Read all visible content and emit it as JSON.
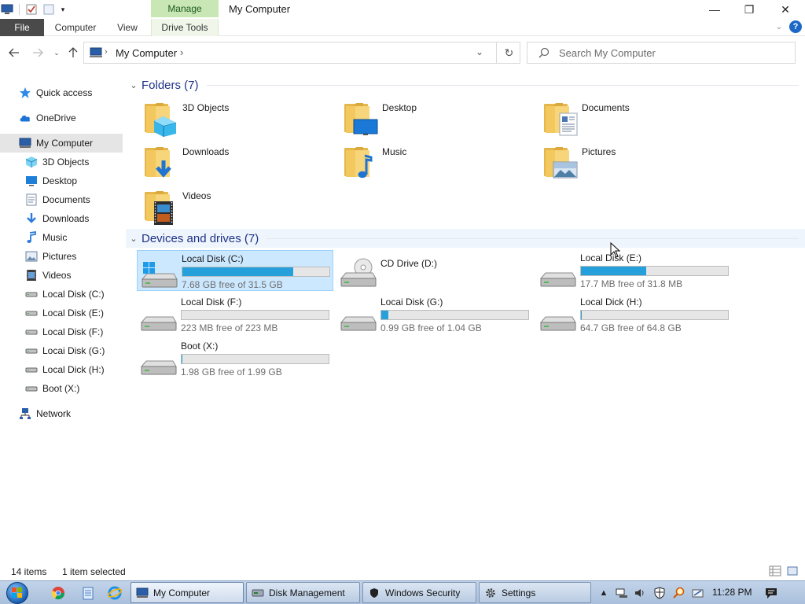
{
  "window": {
    "title": "My Computer",
    "contextual_tab": "Manage",
    "controls": {
      "minimize": "—",
      "maximize": "❐",
      "close": "✕"
    }
  },
  "ribbon": {
    "file": "File",
    "tabs": [
      "Computer",
      "View",
      "Drive Tools"
    ],
    "help": "?"
  },
  "address": {
    "path": "My Computer",
    "search_placeholder": "Search My Computer"
  },
  "nav_pane": {
    "items": [
      {
        "label": "Quick access",
        "icon": "star-icon"
      },
      {
        "label": "OneDrive",
        "icon": "cloud-icon"
      },
      {
        "label": "My Computer",
        "icon": "computer-icon",
        "selected": true
      },
      {
        "label": "3D Objects",
        "icon": "cube-icon"
      },
      {
        "label": "Desktop",
        "icon": "desktop-icon"
      },
      {
        "label": "Documents",
        "icon": "document-icon"
      },
      {
        "label": "Downloads",
        "icon": "download-icon"
      },
      {
        "label": "Music",
        "icon": "music-icon"
      },
      {
        "label": "Pictures",
        "icon": "picture-icon"
      },
      {
        "label": "Videos",
        "icon": "video-icon"
      },
      {
        "label": "Local Disk (C:)",
        "icon": "drive-icon"
      },
      {
        "label": "Local Disk (E:)",
        "icon": "drive-icon"
      },
      {
        "label": "Local Disk (F:)",
        "icon": "drive-icon"
      },
      {
        "label": "Locai Disk (G:)",
        "icon": "drive-icon"
      },
      {
        "label": "Local Dick (H:)",
        "icon": "drive-icon"
      },
      {
        "label": "Boot (X:)",
        "icon": "drive-icon"
      },
      {
        "label": "Network",
        "icon": "network-icon"
      }
    ]
  },
  "folders": {
    "header": "Folders (7)",
    "items": [
      {
        "name": "3D Objects",
        "icon": "cube-icon"
      },
      {
        "name": "Desktop",
        "icon": "desktop-icon"
      },
      {
        "name": "Documents",
        "icon": "document-icon"
      },
      {
        "name": "Downloads",
        "icon": "download-icon"
      },
      {
        "name": "Music",
        "icon": "music-icon"
      },
      {
        "name": "Pictures",
        "icon": "picture-icon"
      },
      {
        "name": "Videos",
        "icon": "video-icon"
      }
    ]
  },
  "drives": {
    "header": "Devices and drives (7)",
    "items": [
      {
        "name": "Local Disk (C:)",
        "free_text": "7.68 GB free of 31.5 GB",
        "used_fraction": 0.756,
        "windows": true,
        "selected": true,
        "has_bar": true
      },
      {
        "name": "CD Drive (D:)",
        "free_text": "",
        "used_fraction": 0,
        "cd": true,
        "has_bar": false
      },
      {
        "name": "Local Disk (E:)",
        "free_text": "17.7 MB free of 31.8 MB",
        "used_fraction": 0.443,
        "has_bar": true
      },
      {
        "name": "Local Disk (F:)",
        "free_text": "223 MB free of 223 MB",
        "used_fraction": 0.0,
        "has_bar": true
      },
      {
        "name": "Locai Disk (G:)",
        "free_text": "0.99 GB free of 1.04 GB",
        "used_fraction": 0.048,
        "has_bar": true
      },
      {
        "name": "Local Dick (H:)",
        "free_text": "64.7 GB free of 64.8 GB",
        "used_fraction": 0.002,
        "has_bar": true
      },
      {
        "name": "Boot (X:)",
        "free_text": "1.98 GB free of 1.99 GB",
        "used_fraction": 0.005,
        "has_bar": true
      }
    ]
  },
  "status": {
    "count": "14 items",
    "selection": "1 item selected"
  },
  "taskbar": {
    "tasks": [
      {
        "label": "My Computer",
        "icon": "computer-icon",
        "active": true
      },
      {
        "label": "Disk Management",
        "icon": "disk-management-icon"
      },
      {
        "label": "Windows Security",
        "icon": "shield-icon"
      },
      {
        "label": "Settings",
        "icon": "gear-icon"
      }
    ],
    "clock": "11:28 PM"
  },
  "colors": {
    "accent": "#26a0da",
    "manage_tab": "#c9e7b4",
    "file_tab": "#4a4a4a",
    "header_text": "#1e3287",
    "selection": "#cce8ff"
  }
}
